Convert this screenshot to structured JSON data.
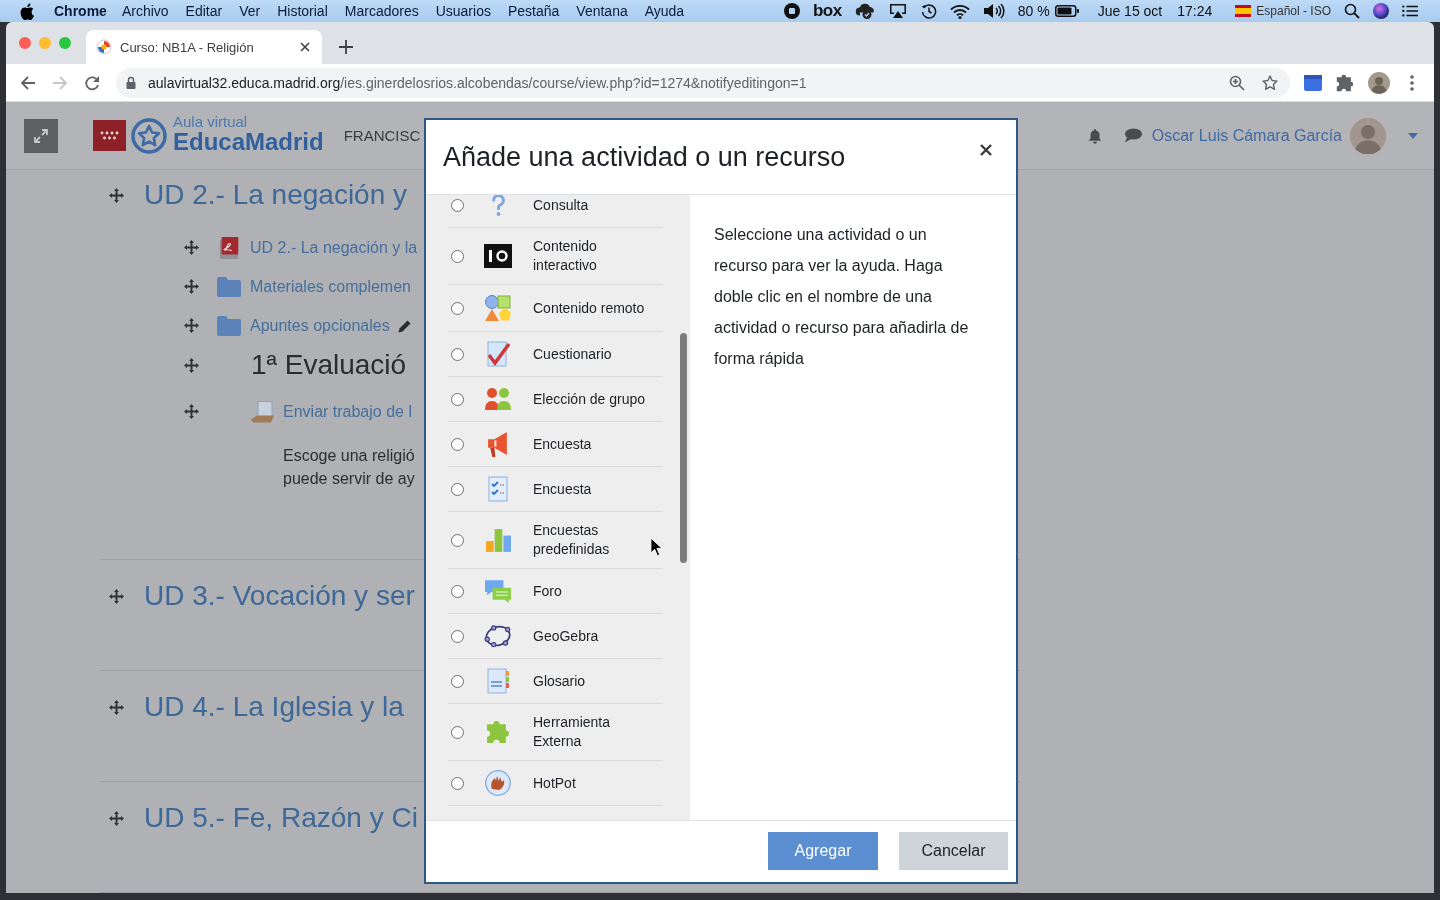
{
  "menubar": {
    "app": "Chrome",
    "menus": [
      "Archivo",
      "Editar",
      "Ver",
      "Historial",
      "Marcadores",
      "Usuarios",
      "Pestaña",
      "Ventana",
      "Ayuda"
    ],
    "box_logo": "box",
    "battery": "80 %",
    "date": "Jue 15 oct",
    "time": "17:24",
    "input_source": "Español - ISO"
  },
  "browser": {
    "tab": {
      "title": "Curso: NB1A - Religión",
      "selected": true
    },
    "nav_buttons": [
      {
        "kind": "back",
        "disabled": false
      },
      {
        "kind": "forward",
        "disabled": true
      },
      {
        "kind": "reload",
        "disabled": false
      }
    ],
    "url": {
      "host": "aulavirtual32.educa.madrid.org",
      "path": "/ies.ginerdelosrios.alcobendas/course/view.php?id=1274&notifyeditingon=1"
    }
  },
  "page": {
    "logo": {
      "line_1": "Aula virtual",
      "line_2": "EducaMadrid"
    },
    "site_name": "FRANCISC",
    "user_name": "Oscar Luis Cámara García",
    "sections": [
      {
        "title": "UD 2.- La negación y",
        "items": [
          {
            "kind": "pdf",
            "text": "UD 2.- La negación y la",
            "edit_icon": false
          },
          {
            "kind": "folder",
            "text": "Materiales complemen",
            "edit_icon": false
          },
          {
            "kind": "folder",
            "text": "Apuntes opcionales",
            "edit_icon": true
          },
          {
            "kind": "label",
            "text": "1ª Evaluació",
            "edit_icon": false
          },
          {
            "kind": "assignment",
            "text": "Enviar trabajo de l",
            "edit_icon": false,
            "description": [
              "Escoge una religió",
              "puede servir de ay"
            ]
          }
        ]
      },
      {
        "title": "UD 3.- Vocación y ser"
      },
      {
        "title": "UD 4.- La Iglesia y la"
      },
      {
        "title": "UD 5.- Fe, Razón y Ci"
      }
    ]
  },
  "dialog": {
    "title": "Añade una actividad o un recurso",
    "options": [
      {
        "label": "Consulta",
        "selected": false
      },
      {
        "label": "Contenido interactivo",
        "selected": false
      },
      {
        "label": "Contenido remoto",
        "selected": false
      },
      {
        "label": "Cuestionario",
        "selected": false
      },
      {
        "label": "Elección de grupo",
        "selected": false
      },
      {
        "label": "Encuesta",
        "selected": false
      },
      {
        "label": "Encuesta",
        "selected": false
      },
      {
        "label": "Encuestas predefinidas",
        "selected": false
      },
      {
        "label": "Foro",
        "selected": false
      },
      {
        "label": "GeoGebra",
        "selected": false
      },
      {
        "label": "Glosario",
        "selected": false
      },
      {
        "label": "Herramienta Externa",
        "selected": false
      },
      {
        "label": "HotPot",
        "selected": false
      }
    ],
    "help": "Seleccione una actividad o un recurso para ver la ayuda. Haga doble clic en el nombre de una actividad o recurso para añadirla de forma rápida",
    "buttons": [
      {
        "label": "Agregar",
        "kind": "primary"
      },
      {
        "label": "Cancelar",
        "kind": "secondary"
      }
    ]
  }
}
